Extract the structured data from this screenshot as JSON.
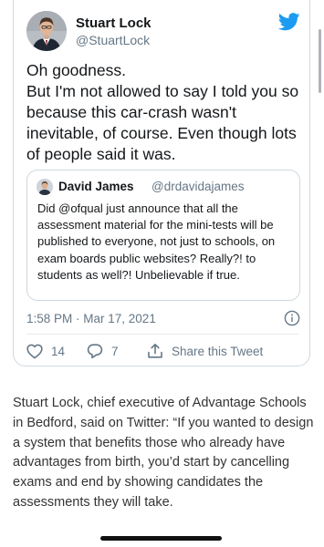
{
  "tweet": {
    "author": {
      "name": "Stuart Lock",
      "handle": "@StuartLock"
    },
    "text": "Oh goodness.\nBut I'm not allowed to say I told you so because this car-crash wasn't inevitable, of course. Even though lots of people said it was.",
    "quoted": {
      "author_name": "David James",
      "author_handle": "@drdavidajames",
      "text": "Did @ofqual just announce that all the assessment material for the mini-tests will be published to everyone, not just to schools, on exam boards public websites? Really?! to students as well?! Unbelievable if true."
    },
    "timestamp": "1:58 PM · Mar 17, 2021",
    "likes": "14",
    "replies": "7",
    "share_label": "Share this Tweet"
  },
  "article": {
    "paragraph": "Stuart Lock, chief executive of Advantage Schools in Bedford, said on Twitter: “If you wanted to design a system that benefits those who already have advantages from birth, you’d start by cancelling exams and end by showing candidates the assessments they will take."
  },
  "colors": {
    "twitter_blue": "#1d9bf0",
    "secondary_text": "#657786",
    "border": "#cfd9de"
  },
  "icons": [
    "twitter-bird-icon",
    "info-icon",
    "heart-icon",
    "reply-icon",
    "share-icon"
  ]
}
